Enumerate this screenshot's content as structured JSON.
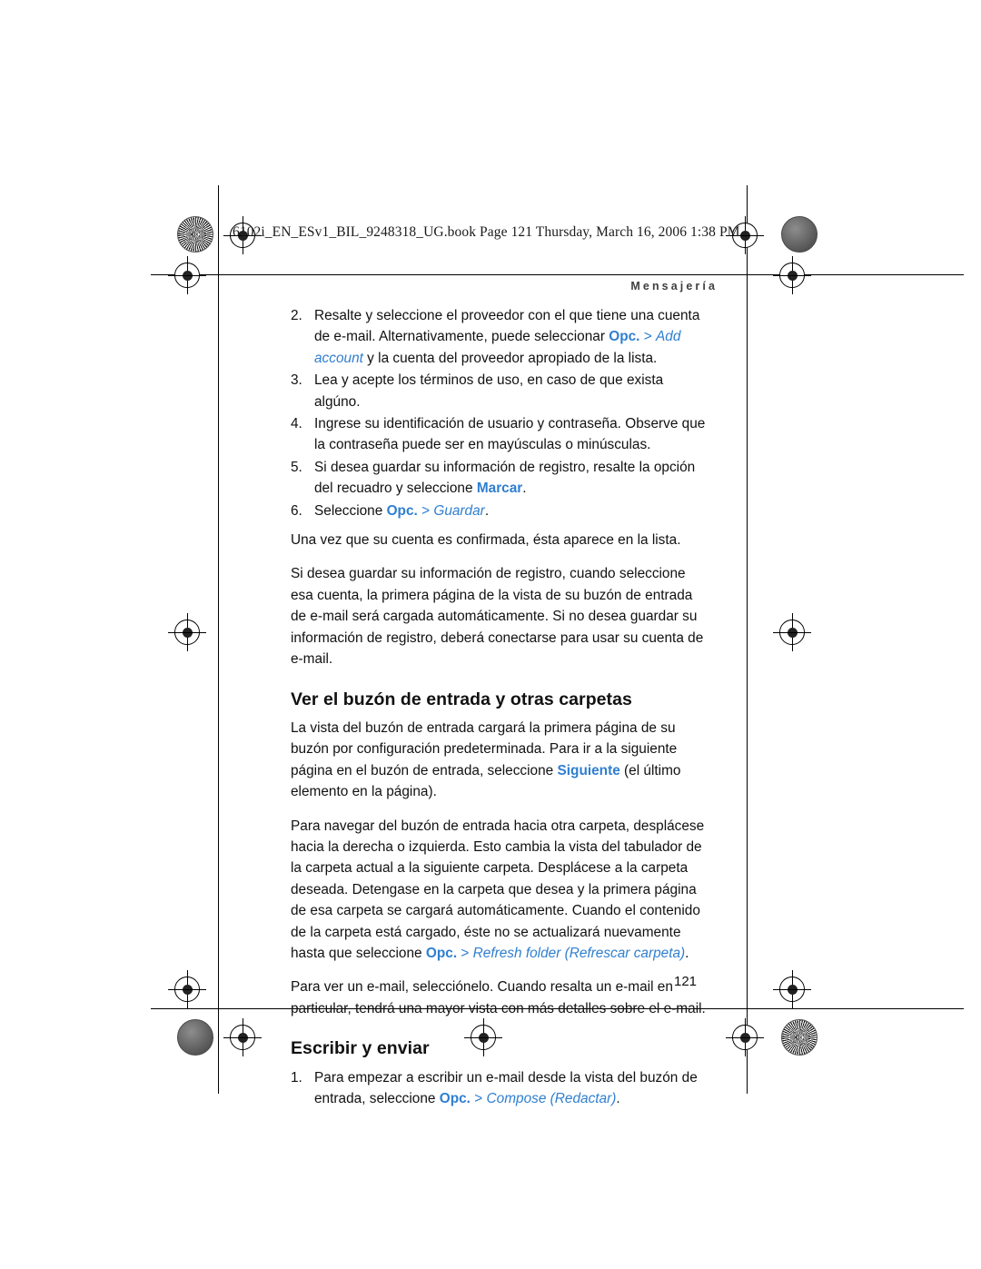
{
  "header": {
    "file_line": "6102i_EN_ESv1_BIL_9248318_UG.book  Page 121  Thursday, March 16, 2006  1:38 PM",
    "running_head": "Mensajería"
  },
  "body": {
    "steps_top": [
      {
        "num": "2.",
        "parts": [
          {
            "t": "Resalte y seleccione el proveedor con el que tiene una cuenta de e-mail. Alternativamente, puede seleccionar ",
            "s": "plain"
          },
          {
            "t": "Opc.",
            "s": "blue-b"
          },
          {
            "t": " > ",
            "s": "blue"
          },
          {
            "t": "Add account",
            "s": "blue-i"
          },
          {
            "t": " y la cuenta del proveedor apropiado de la lista.",
            "s": "plain"
          }
        ]
      },
      {
        "num": "3.",
        "parts": [
          {
            "t": "Lea y acepte los términos de uso, en caso de que exista algúno.",
            "s": "plain"
          }
        ]
      },
      {
        "num": "4.",
        "parts": [
          {
            "t": "Ingrese su identificación de usuario y contraseña. Observe que la contraseña puede ser en mayúsculas o minúsculas.",
            "s": "plain"
          }
        ]
      },
      {
        "num": "5.",
        "parts": [
          {
            "t": "Si desea guardar su información de registro, resalte la opción del recuadro y seleccione ",
            "s": "plain"
          },
          {
            "t": "Marcar",
            "s": "blue-b"
          },
          {
            "t": ".",
            "s": "plain"
          }
        ]
      },
      {
        "num": "6.",
        "parts": [
          {
            "t": "Seleccione ",
            "s": "plain"
          },
          {
            "t": "Opc.",
            "s": "blue-b"
          },
          {
            "t": " > ",
            "s": "blue"
          },
          {
            "t": "Guardar",
            "s": "blue-i"
          },
          {
            "t": ".",
            "s": "plain"
          }
        ]
      }
    ],
    "para_confirm": "Una vez que su cuenta es confirmada, ésta aparece en la lista.",
    "para_save": "Si desea guardar su información de registro, cuando seleccione esa cuenta, la primera página de la vista de su buzón de entrada de e-mail será cargada automáticamente. Si no desea guardar su información de registro, deberá conectarse para usar su cuenta de e-mail.",
    "heading_inbox": "Ver el buzón de entrada y otras carpetas",
    "para_inbox_1": [
      {
        "t": "La vista del buzón de entrada cargará la primera página de su buzón por configuración predeterminada. Para ir a la siguiente página en el buzón de entrada, seleccione ",
        "s": "plain"
      },
      {
        "t": "Siguiente",
        "s": "blue-b"
      },
      {
        "t": " (el último elemento en la página).",
        "s": "plain"
      }
    ],
    "para_inbox_2": [
      {
        "t": "Para navegar del buzón de entrada hacia otra carpeta, desplácese hacia la derecha o izquierda. Esto cambia la vista del tabulador de la carpeta actual a la siguiente carpeta. Desplácese a la carpeta deseada. Detengase en la carpeta que desea y la primera página de esa carpeta se cargará automáticamente. Cuando el contenido de la carpeta está cargado, éste no se actualizará nuevamente hasta que seleccione ",
        "s": "plain"
      },
      {
        "t": "Opc.",
        "s": "blue-b"
      },
      {
        "t": " > ",
        "s": "blue"
      },
      {
        "t": "Refresh folder (Refrescar carpeta)",
        "s": "blue-i"
      },
      {
        "t": ".",
        "s": "plain"
      }
    ],
    "para_inbox_3": "Para ver un e-mail, selecciónelo. Cuando resalta un e-mail en particular, tendrá una mayor vista con más detalles sobre el e-mail.",
    "heading_compose": "Escribir y enviar",
    "steps_bottom": [
      {
        "num": "1.",
        "parts": [
          {
            "t": "Para empezar a escribir un e-mail desde la vista del buzón de entrada, seleccione ",
            "s": "plain"
          },
          {
            "t": "Opc.",
            "s": "blue-b"
          },
          {
            "t": " > ",
            "s": "blue"
          },
          {
            "t": "Compose (Redactar)",
            "s": "blue-i"
          },
          {
            "t": ".",
            "s": "plain"
          }
        ]
      }
    ],
    "page_number": "121"
  },
  "colors": {
    "accent_blue": "#2f7fd0",
    "text": "#111111",
    "running_head": "#3f3f3f"
  }
}
